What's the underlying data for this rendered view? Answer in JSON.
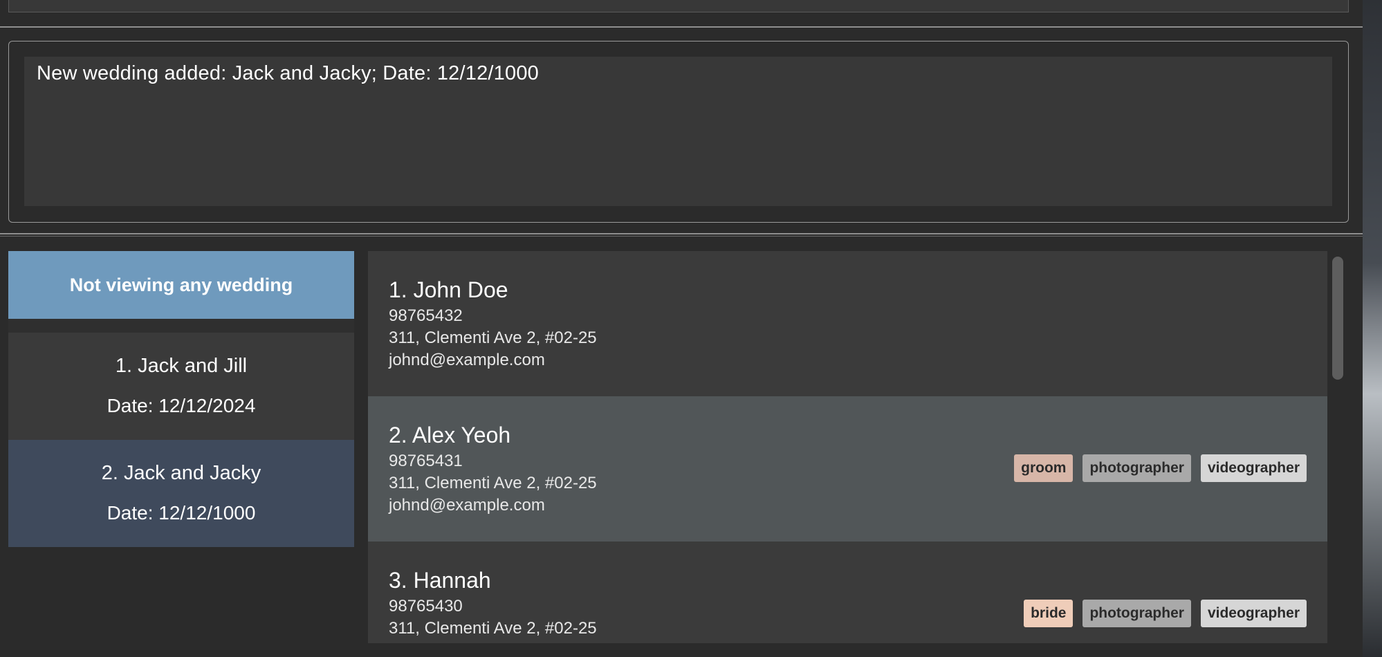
{
  "result_display": {
    "message": "New wedding added: Jack and Jacky; Date: 12/12/1000"
  },
  "wedding_panel": {
    "header": "Not viewing any wedding",
    "weddings": [
      {
        "name": "1. Jack and Jill",
        "date": "Date: 12/12/2024"
      },
      {
        "name": "2. Jack and Jacky",
        "date": "Date: 12/12/1000"
      }
    ]
  },
  "person_list": {
    "persons": [
      {
        "name": "1. John Doe",
        "phone": "98765432",
        "address": "311, Clementi Ave 2, #02-25",
        "email": "johnd@example.com",
        "tags": []
      },
      {
        "name": "2. Alex Yeoh",
        "phone": "98765431",
        "address": "311, Clementi Ave 2, #02-25",
        "email": "johnd@example.com",
        "tags": [
          "groom",
          "photographer",
          "videographer"
        ]
      },
      {
        "name": "3. Hannah",
        "phone": "98765430",
        "address": "311, Clementi Ave 2, #02-25",
        "email": "",
        "tags": [
          "bride",
          "photographer",
          "videographer"
        ]
      }
    ]
  },
  "colors": {
    "wedding_header_bg": "#6f9abd",
    "selected_wedding_bg": "#3f4a5c",
    "selected_person_bg": "#515658",
    "tag_groom": "#d7b6a8",
    "tag_bride": "#efcdb9",
    "tag_photographer": "#a9a9a9",
    "tag_videographer": "#d6d6d6"
  }
}
